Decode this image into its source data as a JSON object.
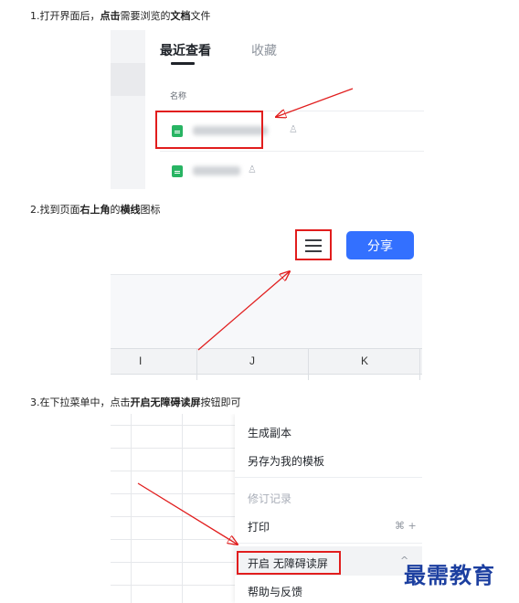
{
  "steps": {
    "s1": {
      "pre": "1.打开界面后，",
      "bold1": "点击",
      "mid1": "需要浏览的",
      "bold2": "文档",
      "post": "文件"
    },
    "s2": {
      "pre": "2.找到页面",
      "bold1": "右上角",
      "mid1": "的",
      "bold2": "横线",
      "post": "图标"
    },
    "s3": {
      "pre": "3.在下拉菜单中，点击",
      "bold1": "开启无障碍读屏",
      "post": "按钮即可"
    }
  },
  "panel1": {
    "tab_recent": "最近查看",
    "tab_favorites": "收藏",
    "column_name": "名称",
    "files": [
      {
        "icon": "sheet-icon",
        "shared_icon": "person-icon"
      },
      {
        "icon": "sheet-icon",
        "shared_icon": "person-icon"
      }
    ]
  },
  "panel2": {
    "menu_icon": "hamburger-icon",
    "share_label": "分享",
    "columns": [
      "I",
      "J",
      "K"
    ]
  },
  "panel3": {
    "menu_items": [
      {
        "label": "生成副本"
      },
      {
        "label": "另存为我的模板"
      },
      {
        "label": "修订记录",
        "disabled": true
      },
      {
        "label": "打印",
        "shortcut": "⌘ +"
      },
      {
        "label": "开启 无障碍读屏",
        "expand": "^"
      },
      {
        "label": "帮助与反馈"
      }
    ]
  },
  "watermark": "最需教育",
  "colors": {
    "highlight": "#e11d1d",
    "share_button": "#3370ff",
    "sheet_icon": "#28b463",
    "watermark": "#1c3fa0"
  }
}
